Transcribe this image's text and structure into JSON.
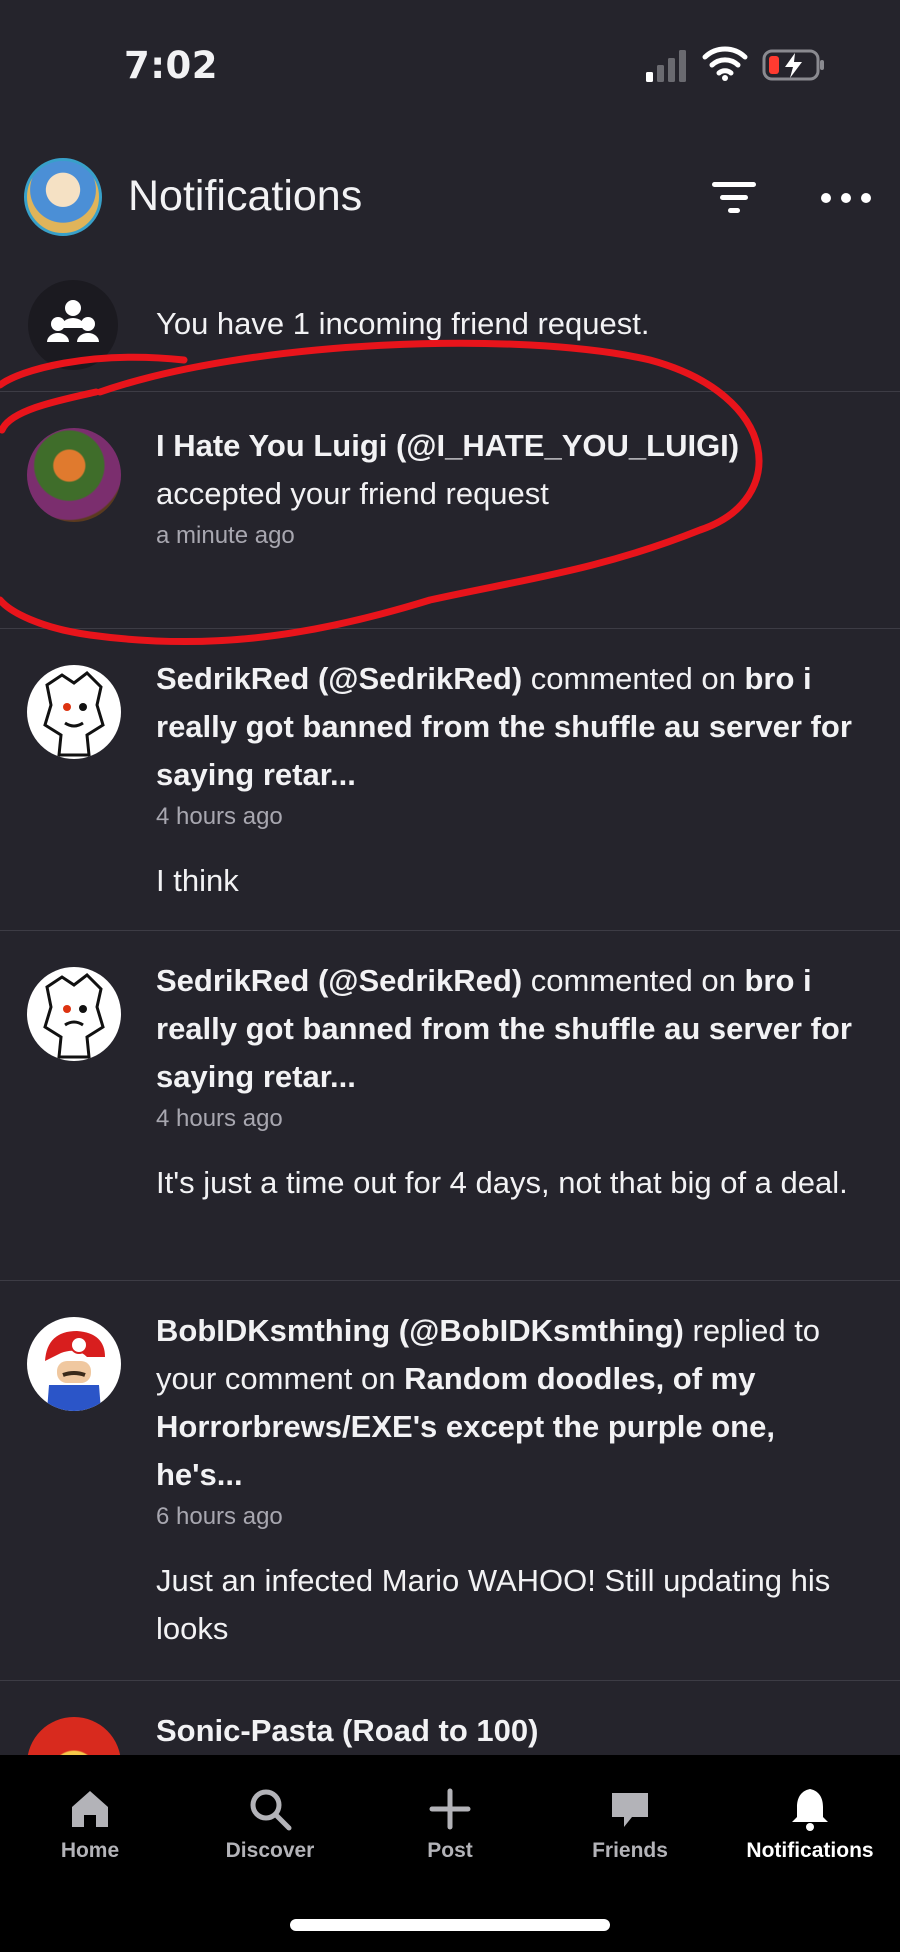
{
  "status": {
    "time": "7:02"
  },
  "header": {
    "title": "Notifications"
  },
  "friend_request": {
    "text": "You have 1 incoming friend request."
  },
  "notifications": [
    {
      "user": "I Hate You Luigi (@I_HATE_YOU_LUIGI)",
      "action": "accepted your friend request",
      "time": "a minute ago"
    },
    {
      "user": "SedrikRed (@SedrikRed)",
      "action_pre": "commented on",
      "post": "bro i really got banned from the shuffle au server for saying retar...",
      "time": "4 hours ago",
      "comment": "I think"
    },
    {
      "user": "SedrikRed (@SedrikRed)",
      "action_pre": "commented on",
      "post": "bro i really got banned from the shuffle au server for saying retar...",
      "time": "4 hours ago",
      "comment": "It's just a time out for 4 days, not that big of a deal."
    },
    {
      "user": "BobIDKsmthing (@BobIDKsmthing)",
      "action_pre": "replied to your comment on",
      "post": "Random doodles, of my Horrorbrews/EXE's except the purple one, he's...",
      "time": "6 hours ago",
      "comment": "Just an infected Mario WAHOO! Still updating his looks"
    },
    {
      "user": "Sonic-Pasta (Road to 100)"
    }
  ],
  "tabs": [
    {
      "label": "Home",
      "icon": "home-icon"
    },
    {
      "label": "Discover",
      "icon": "search-icon"
    },
    {
      "label": "Post",
      "icon": "plus-icon"
    },
    {
      "label": "Friends",
      "icon": "chat-bubble-icon"
    },
    {
      "label": "Notifications",
      "icon": "bell-icon",
      "active": true
    }
  ],
  "colors": {
    "background": "#25242c",
    "annotation": "#e8141b",
    "tabbar": "#000000"
  }
}
